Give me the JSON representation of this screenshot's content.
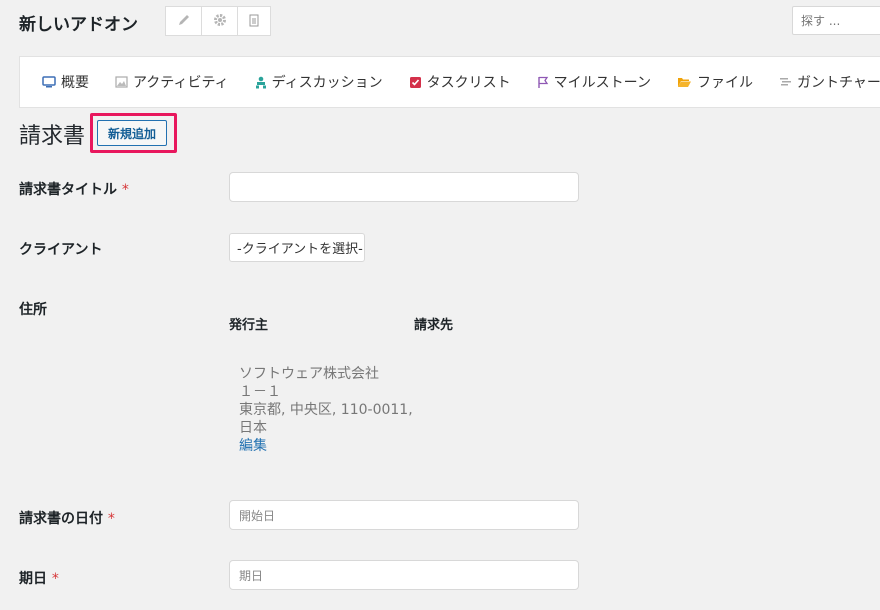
{
  "header": {
    "project_title": "新しいアドオン",
    "search_placeholder": "探す ..."
  },
  "tabs": [
    {
      "label": "概要",
      "icon": "monitor-icon",
      "color": "#3d6fb6"
    },
    {
      "label": "アクティビティ",
      "icon": "image-icon",
      "color": "#999999"
    },
    {
      "label": "ディスカッション",
      "icon": "users-icon",
      "color": "#2aa39a"
    },
    {
      "label": "タスクリスト",
      "icon": "checkbox-icon",
      "color": "#d4304a"
    },
    {
      "label": "マイルストーン",
      "icon": "flag-icon",
      "color": "#8f58b4"
    },
    {
      "label": "ファイル",
      "icon": "folder-icon",
      "color": "#f0a30a"
    },
    {
      "label": "ガントチャート",
      "icon": "bars-icon",
      "color": "#999999"
    }
  ],
  "page": {
    "heading": "請求書",
    "add_new_label": "新規追加"
  },
  "form": {
    "title_label": "請求書タイトル",
    "client_label": "クライアント",
    "client_select": "-クライアントを選択-",
    "address_label": "住所",
    "issuer_head": "発行主",
    "billto_head": "請求先",
    "address_lines": [
      "ソフトウェア株式会社",
      "１－１",
      "東京都, 中央区, 110-0011,",
      "日本"
    ],
    "address_edit": "編集",
    "date_label": "請求書の日付",
    "date_placeholder": "開始日",
    "due_label": "期日",
    "due_placeholder": "期日",
    "required_mark": "*"
  }
}
